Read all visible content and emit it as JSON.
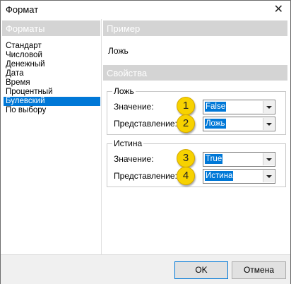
{
  "window": {
    "title": "Формат",
    "close_glyph": "✕"
  },
  "formats": {
    "header": "Форматы",
    "items": [
      {
        "label": "Стандарт",
        "selected": false
      },
      {
        "label": "Числовой",
        "selected": false
      },
      {
        "label": "Денежный",
        "selected": false
      },
      {
        "label": "Дата",
        "selected": false
      },
      {
        "label": "Время",
        "selected": false
      },
      {
        "label": "Процентный",
        "selected": false
      },
      {
        "label": "Булевский",
        "selected": true
      },
      {
        "label": "По выбору",
        "selected": false
      }
    ]
  },
  "preview": {
    "header": "Пример",
    "sample": "Ложь"
  },
  "properties": {
    "header": "Свойства",
    "false_group": {
      "title": "Ложь",
      "value_label": "Значение:",
      "value": "False",
      "repr_label": "Представление:",
      "repr": "Ложь"
    },
    "true_group": {
      "title": "Истина",
      "value_label": "Значение:",
      "value": "True",
      "repr_label": "Представление:",
      "repr": "Истина"
    }
  },
  "badges": [
    "1",
    "2",
    "3",
    "4"
  ],
  "buttons": {
    "ok": "OK",
    "cancel": "Отмена"
  },
  "colors": {
    "selection": "#0078d7",
    "badge": "#f7d200",
    "header_bg": "#d4d4d4"
  }
}
